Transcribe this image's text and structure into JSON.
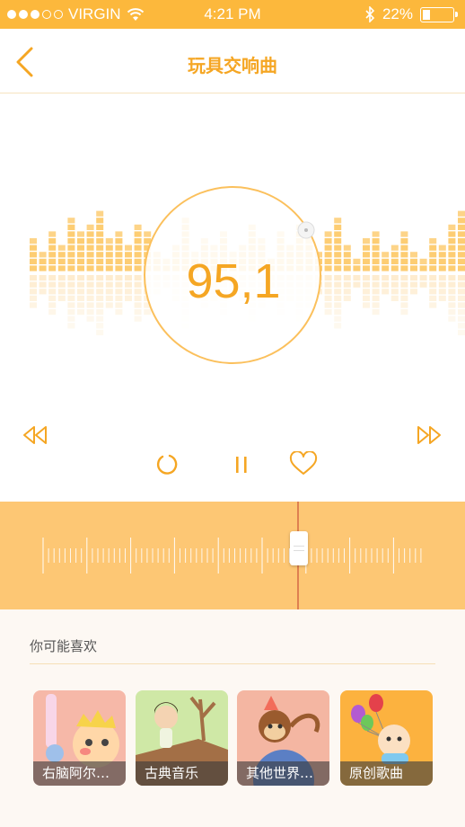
{
  "status_bar": {
    "carrier": "VIRGIN",
    "time": "4:21 PM",
    "battery": "22%",
    "battery_level": 0.22,
    "signal_bars": 3
  },
  "nav": {
    "title": "玩具交响曲",
    "back_icon": "chevron-left-icon"
  },
  "player": {
    "frequency": "95,1",
    "accent": "#f5a623",
    "controls": {
      "rewind": "rewind-icon",
      "forward": "fast-forward-icon",
      "loop": "loop-icon",
      "pause": "pause-icon",
      "favorite": "heart-icon"
    }
  },
  "recommend": {
    "heading": "你可能喜欢",
    "items": [
      {
        "label": "右脑阿尔…",
        "color": "#f6b8a8"
      },
      {
        "label": "古典音乐",
        "color": "#cfe8a6"
      },
      {
        "label": "其他世界…",
        "color": "#f4b6a2"
      },
      {
        "label": "原创歌曲",
        "color": "#fcb23f"
      }
    ]
  }
}
